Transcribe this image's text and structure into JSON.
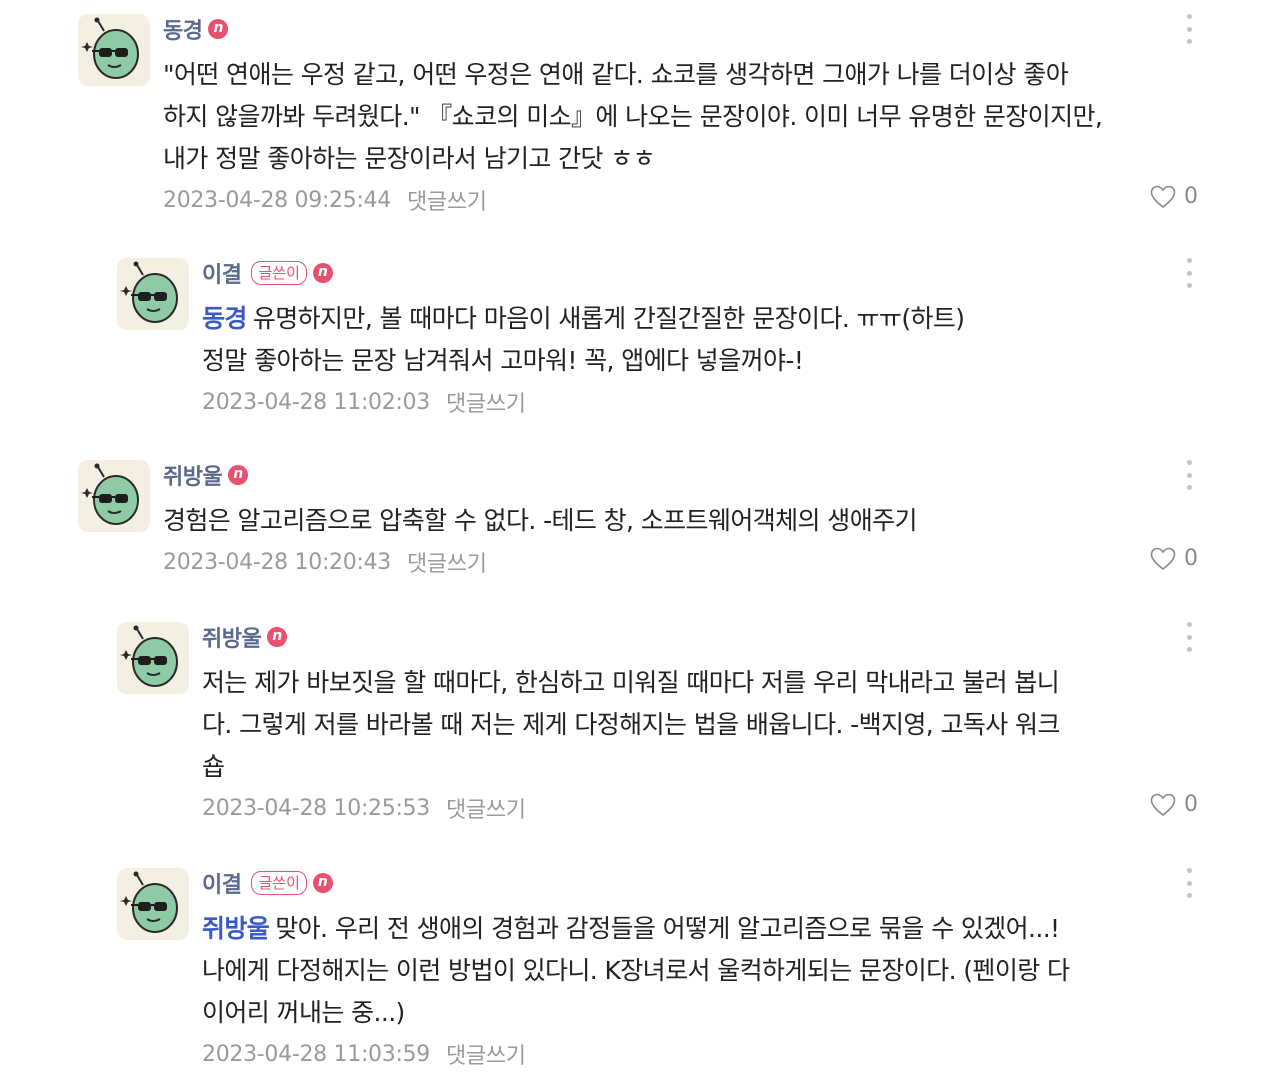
{
  "comments": [
    {
      "author": "동경",
      "is_writer": false,
      "mention": "",
      "lines": [
        "\"어떤 연애는 우정 같고, 어떤 우정은 연애 같다. 쇼코를 생각하면 그애가 나를 더이상 좋아",
        "하지 않을까봐 두려웠다.\" 『쇼코의 미소』에 나오는 문장이야. 이미 너무 유명한 문장이지만,",
        "내가 정말 좋아하는 문장이라서 남기고 간닷 ㅎㅎ"
      ],
      "timestamp": "2023-04-28 09:25:44",
      "reply_label": "댓글쓰기",
      "likes": "0",
      "show_like": true
    },
    {
      "author": "이결",
      "is_writer": true,
      "writer_badge": "글쓴이",
      "mention": "동경",
      "lines": [
        "유명하지만, 볼 때마다 마음이 새롭게 간질간질한 문장이다. ㅠㅠ(하트)",
        "정말 좋아하는 문장 남겨줘서 고마워! 꼭, 앱에다 넣을꺼야-!"
      ],
      "timestamp": "2023-04-28 11:02:03",
      "reply_label": "댓글쓰기",
      "show_like": false
    },
    {
      "author": "쥐방울",
      "is_writer": false,
      "mention": "",
      "lines": [
        "경험은 알고리즘으로 압축할 수 없다. -테드 창, 소프트웨어객체의 생애주기"
      ],
      "timestamp": "2023-04-28 10:20:43",
      "reply_label": "댓글쓰기",
      "likes": "0",
      "show_like": true
    },
    {
      "author": "쥐방울",
      "is_writer": false,
      "mention": "",
      "lines": [
        "저는 제가 바보짓을 할 때마다, 한심하고 미워질 때마다 저를 우리 막내라고 불러 봅니",
        "다. 그렇게 저를 바라볼 때 저는 제게 다정해지는 법을 배웁니다. -백지영, 고독사 워크",
        "숍"
      ],
      "timestamp": "2023-04-28 10:25:53",
      "reply_label": "댓글쓰기",
      "likes": "0",
      "show_like": true
    },
    {
      "author": "이결",
      "is_writer": true,
      "writer_badge": "글쓴이",
      "mention": "쥐방울",
      "lines": [
        "맞아. 우리 전 생애의 경험과 감정들을 어떻게 알고리즘으로 묶을 수 있겠어...!",
        "나에게 다정해지는 이런 방법이 있다니. K장녀로서 울컥하게되는 문장이다. (펜이랑 다",
        "이어리 꺼내는 중...)"
      ],
      "timestamp": "2023-04-28 11:03:59",
      "reply_label": "댓글쓰기",
      "show_like": false
    }
  ],
  "badge_n": "n",
  "colors": {
    "author": "#5a6a8e",
    "mention": "#3b59c7",
    "badge": "#e8506f",
    "meta": "#9a9a9a",
    "avatar_bg": "#f4efe3",
    "avatar_face": "#8fcaa6"
  },
  "icons": {
    "more": "more-vertical-icon",
    "like": "heart-outline-icon",
    "avatar": "green-alien-sunglasses-avatar"
  }
}
